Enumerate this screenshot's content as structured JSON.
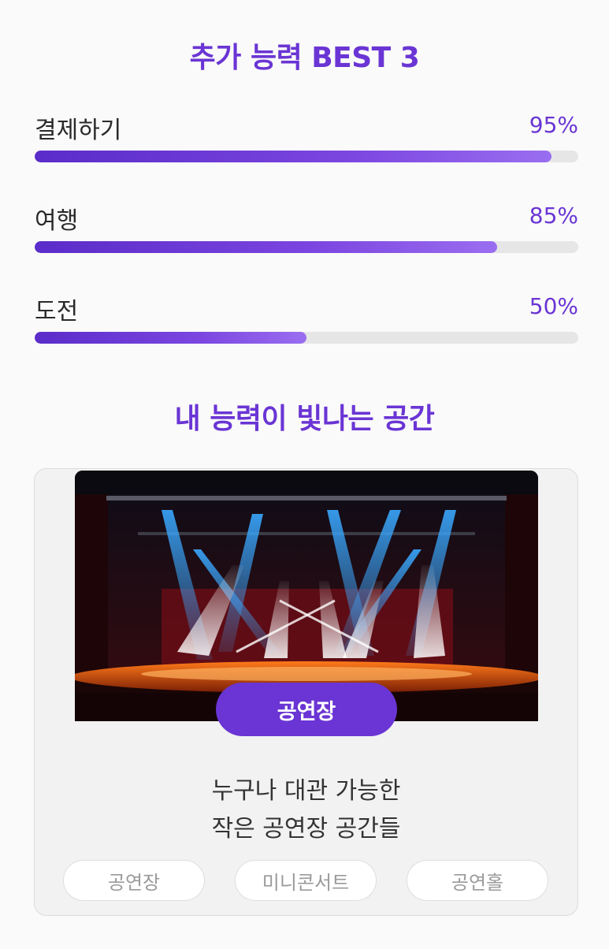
{
  "skills_section": {
    "title": "추가 능력 BEST 3",
    "items": [
      {
        "label": "결제하기",
        "percent_text": "95%",
        "value": 0.95
      },
      {
        "label": "여행",
        "percent_text": "85%",
        "value": 0.85
      },
      {
        "label": "도전",
        "percent_text": "50%",
        "value": 0.5
      }
    ]
  },
  "space_section": {
    "title": "내 능력이 빛나는 공간",
    "card": {
      "image_icon": "concert-stage-photo",
      "button_label": "공연장",
      "description_line1": "누구나 대관 가능한",
      "description_line2": "작은 공연장 공간들",
      "tags": [
        "공연장",
        "미니콘서트",
        "공연홀"
      ]
    }
  },
  "colors": {
    "accent": "#6a35d4",
    "bar_track": "#e6e6e6",
    "card_bg": "#f2f2f2"
  }
}
